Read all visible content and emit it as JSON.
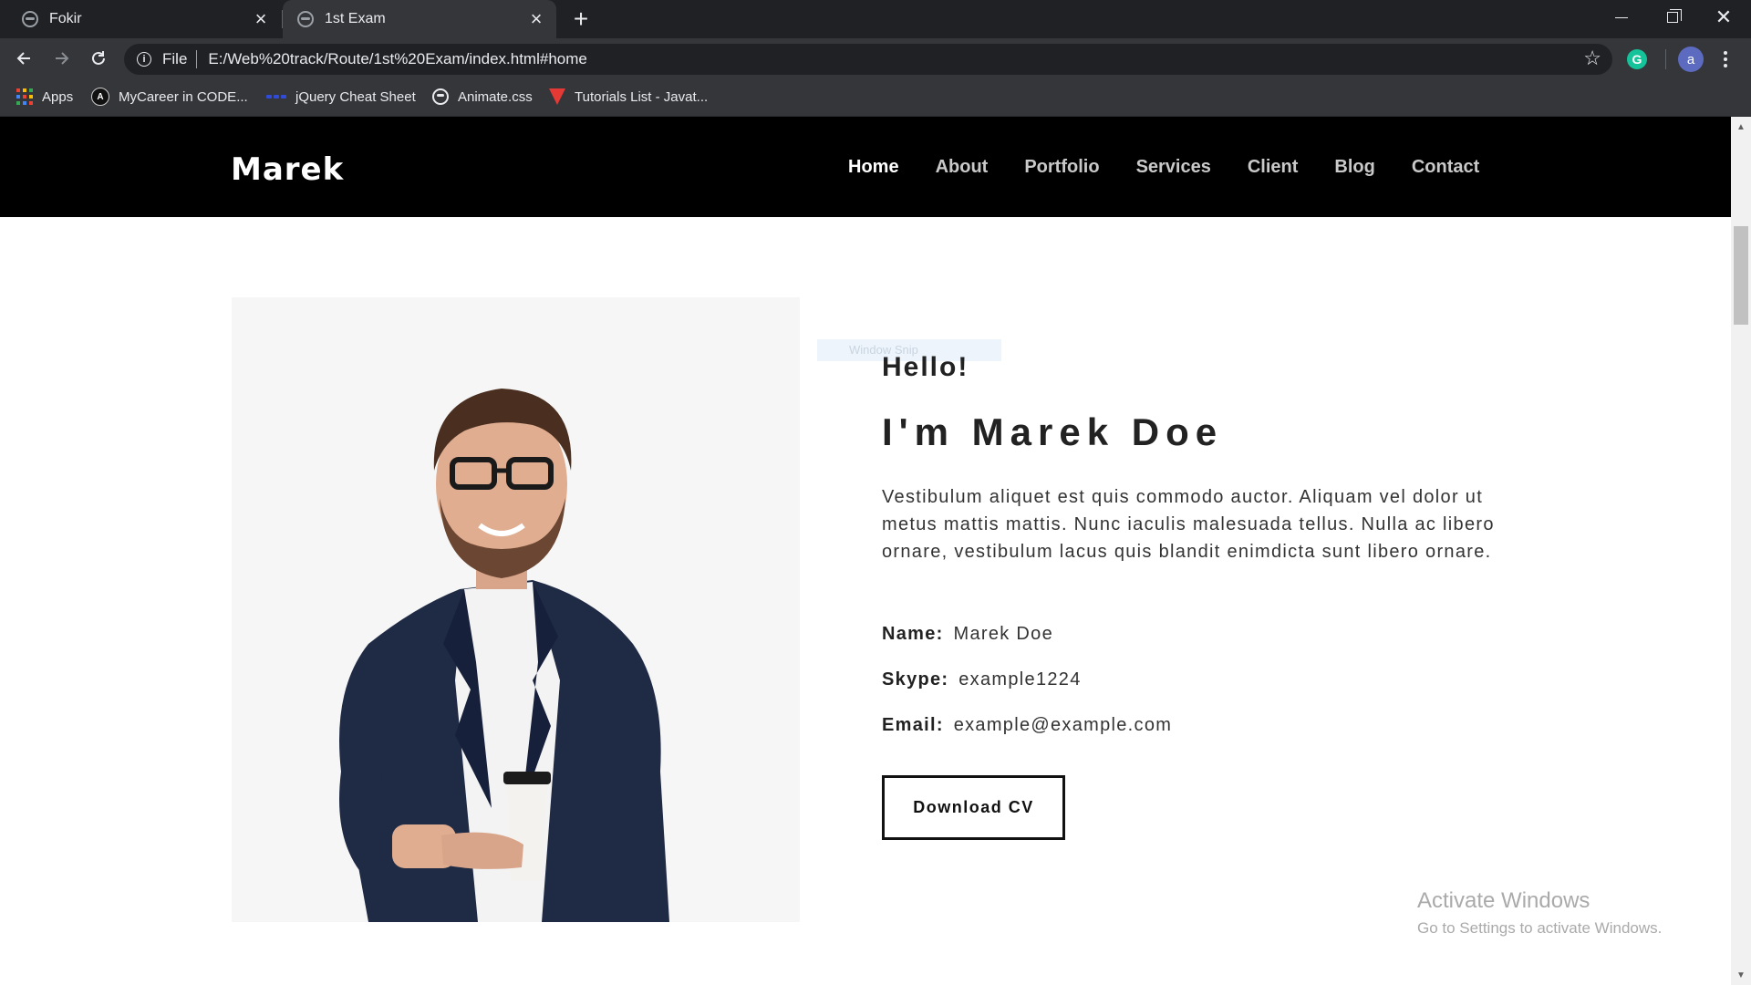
{
  "browser": {
    "tabs": [
      {
        "title": "Fokir",
        "active": false
      },
      {
        "title": "1st Exam",
        "active": true
      }
    ],
    "address": {
      "scheme_label": "File",
      "url": "E:/Web%20track/Route/1st%20Exam/index.html#home"
    },
    "profile_initial": "a",
    "extension_initial": "G",
    "bookmarks": [
      {
        "label": "Apps",
        "icon": "apps-grid-icon"
      },
      {
        "label": "MyCareer in CODE...",
        "icon": "mycareer-icon"
      },
      {
        "label": "jQuery Cheat Sheet",
        "icon": "jquery-icon"
      },
      {
        "label": "Animate.css",
        "icon": "globe-icon"
      },
      {
        "label": "Tutorials List - Javat...",
        "icon": "tutorials-icon"
      }
    ],
    "colors": {
      "chrome_dark": "#202124",
      "chrome_tab": "#35363a",
      "grammarly": "#15c39a",
      "avatar": "#5c6bc0"
    }
  },
  "site": {
    "logo": "Marek",
    "nav": [
      {
        "label": "Home",
        "active": true
      },
      {
        "label": "About",
        "active": false
      },
      {
        "label": "Portfolio",
        "active": false
      },
      {
        "label": "Services",
        "active": false
      },
      {
        "label": "Client",
        "active": false
      },
      {
        "label": "Blog",
        "active": false
      },
      {
        "label": "Contact",
        "active": false
      }
    ]
  },
  "about": {
    "snip_overlay": "Window Snip",
    "greeting": "Hello!",
    "title": "I'm Marek Doe",
    "bio": "Vestibulum aliquet est quis commodo auctor. Aliquam vel dolor ut metus mattis mattis. Nunc iaculis malesuada tellus. Nulla ac libero ornare, vestibulum lacus quis blandit enimdicta sunt libero ornare.",
    "details": [
      {
        "label": "Name:",
        "value": "Marek Doe"
      },
      {
        "label": "Skype:",
        "value": "example1224"
      },
      {
        "label": "Email:",
        "value": "example@example.com"
      }
    ],
    "cta": "Download CV"
  },
  "watermark": {
    "line1": "Activate Windows",
    "line2": "Go to Settings to activate Windows."
  }
}
